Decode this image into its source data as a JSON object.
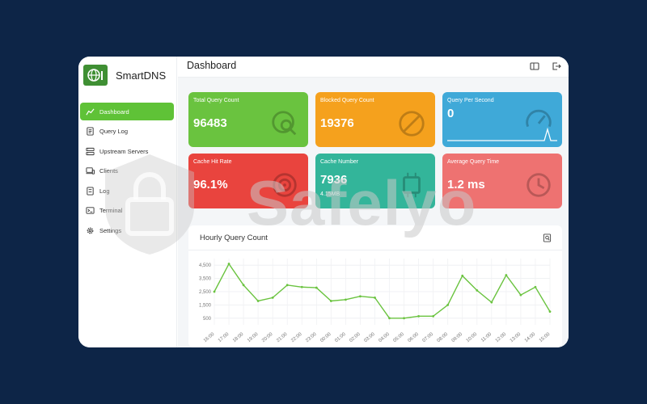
{
  "app": {
    "name": "SmartDNS"
  },
  "header": {
    "title": "Dashboard"
  },
  "sidebar": {
    "items": [
      {
        "label": "Dashboard",
        "icon": "chart-line-icon",
        "active": true
      },
      {
        "label": "Query Log",
        "icon": "document-list-icon",
        "active": false
      },
      {
        "label": "Upstream Servers",
        "icon": "server-icon",
        "active": false
      },
      {
        "label": "Clients",
        "icon": "devices-icon",
        "active": false
      },
      {
        "label": "Log",
        "icon": "log-file-icon",
        "active": false
      },
      {
        "label": "Terminal",
        "icon": "terminal-icon",
        "active": false
      },
      {
        "label": "Settings",
        "icon": "gear-icon",
        "active": false
      }
    ]
  },
  "cards": [
    {
      "title": "Total Query Count",
      "value": "96483",
      "color": "#6ac33f",
      "icon": "search-globe-icon"
    },
    {
      "title": "Blocked Query Count",
      "value": "19376",
      "color": "#f5a11d",
      "icon": "block-icon"
    },
    {
      "title": "Query Per Second",
      "value": "0",
      "color": "#3fa9d8",
      "icon": "speedometer-icon"
    },
    {
      "title": "Cache Hit Rate",
      "value": "96.1%",
      "color": "#e9443e",
      "icon": "target-icon"
    },
    {
      "title": "Cache Number",
      "value": "7936",
      "sub": "4.15MB",
      "color": "#33b59a",
      "icon": "chip-icon"
    },
    {
      "title": "Average Query Time",
      "value": "1.2 ms",
      "color": "#ee7271",
      "icon": "clock-icon"
    }
  ],
  "watermark": {
    "text": "Safelyo"
  },
  "chart_data": {
    "type": "line",
    "title": "Hourly Query Count",
    "categories": [
      "16:00",
      "17:00",
      "18:00",
      "19:00",
      "20:00",
      "21:00",
      "22:00",
      "23:00",
      "00:00",
      "01:00",
      "02:00",
      "03:00",
      "04:00",
      "05:00",
      "06:00",
      "07:00",
      "08:00",
      "09:00",
      "10:00",
      "11:00",
      "12:00",
      "13:00",
      "14:00",
      "15:00"
    ],
    "values": [
      2500,
      4600,
      3000,
      1800,
      2050,
      3000,
      2850,
      2800,
      1800,
      1900,
      2150,
      2050,
      500,
      500,
      650,
      650,
      1500,
      3700,
      2600,
      1700,
      3750,
      2250,
      2850,
      1000
    ],
    "yticks": [
      "500",
      "1,500",
      "2,500",
      "3,500",
      "4,500"
    ],
    "ylim": [
      0,
      5000
    ],
    "line_color": "#6ac33f",
    "grid": true
  }
}
